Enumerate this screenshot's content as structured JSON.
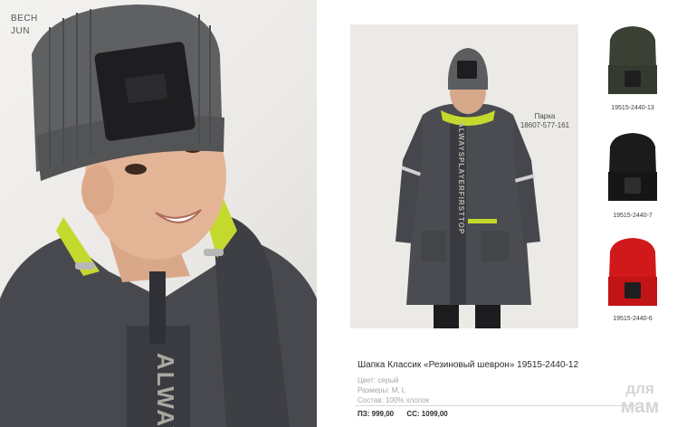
{
  "hero": {
    "brand_label_line1": "BECH",
    "brand_label_line2": "JUN",
    "jacket_print": "ALWAY"
  },
  "product_photo": {
    "jacket_print": "ALWAYSPLAYERFIRSTTOP",
    "parka_label": "Парка",
    "parka_code": "18607-577-161"
  },
  "swatches": [
    {
      "code": "19515-2440-13",
      "color": "#3b4034"
    },
    {
      "code": "19515-2440-7",
      "color": "#1b1b1b"
    },
    {
      "code": "19515-2440-6",
      "color": "#d1181b"
    }
  ],
  "product": {
    "title": "Шапка Классик «Резиновый шеврон»  19515-2440-12",
    "color": "Цвет: серый",
    "sizes": "Размеры: M, L",
    "composition": "Состав: 100% хлопок",
    "price_pz": "ПЗ: 999,00",
    "price_ss": "СС: 1099,00"
  },
  "watermark": {
    "line1": "для",
    "line2": "мам"
  },
  "colors": {
    "hat_gray": "#5c5d5f",
    "jacket_gray": "#4a4b50",
    "accent_lime": "#c4d92e"
  }
}
